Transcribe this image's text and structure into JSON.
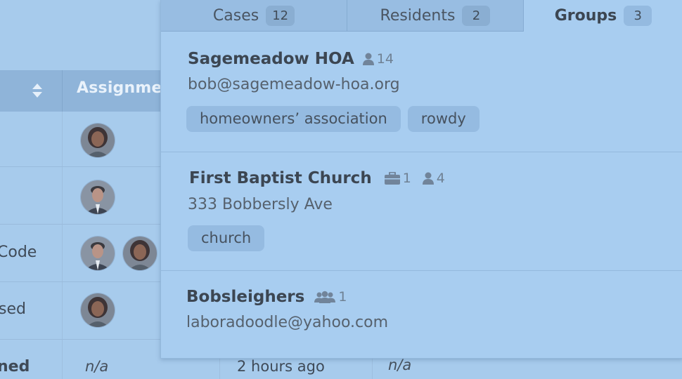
{
  "table": {
    "assignee_header": "Assignment",
    "rows": [
      {
        "label": ""
      },
      {
        "label": ""
      },
      {
        "label": "Code"
      },
      {
        "label": "sed"
      },
      {
        "label": "ned",
        "na_1": "n/a",
        "time": "2 hours ago",
        "na_2": "n/a"
      }
    ]
  },
  "tabs": [
    {
      "label": "Cases",
      "count": "12"
    },
    {
      "label": "Residents",
      "count": "2"
    },
    {
      "label": "Groups",
      "count": "3"
    }
  ],
  "groups": [
    {
      "name": "Sagemeadow HOA",
      "people_count": "14",
      "subtitle": "bob@sagemeadow-hoa.org",
      "tags": [
        "homeowners’ association",
        "rowdy"
      ]
    },
    {
      "name": "First Baptist Church",
      "cases_count": "1",
      "people_count": "4",
      "subtitle": "333 Bobbersly Ave",
      "tags": [
        "church"
      ]
    },
    {
      "name": "Bobsleighers",
      "groups_count": "1",
      "subtitle": "laboradoodle@yahoo.com"
    }
  ],
  "colors": {
    "overlay": "#a7cbec",
    "header": "#8fb4d9",
    "tag": "#95bbe1"
  }
}
